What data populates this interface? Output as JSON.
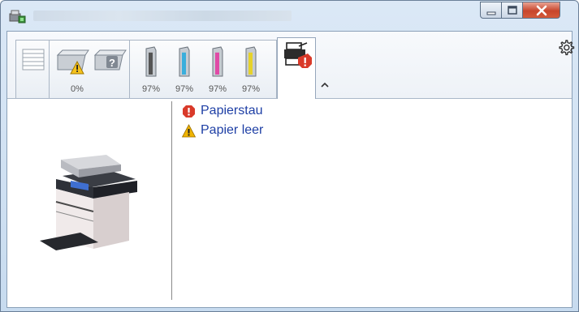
{
  "window": {
    "icons": {
      "app": "printer-app-icon",
      "minimize": "minimize-icon",
      "maximize": "maximize-icon",
      "close": "close-icon"
    }
  },
  "toolbar": {
    "machine_percent": "0%",
    "toner_levels": [
      {
        "color": "#555555",
        "percent": "97%",
        "level": 0.97
      },
      {
        "color": "#3aaedc",
        "percent": "97%",
        "level": 0.97
      },
      {
        "color": "#e04aa6",
        "percent": "97%",
        "level": 0.97
      },
      {
        "color": "#e6d22a",
        "percent": "97%",
        "level": 0.97
      }
    ],
    "icons": {
      "paper": "paper-stack-icon",
      "machine_warning": "tray-warning-icon",
      "machine_unknown": "tray-unknown-icon",
      "status": "printer-error-icon",
      "collapse": "chevron-up-icon",
      "settings": "gear-icon"
    }
  },
  "alerts": [
    {
      "text": "Papierstau",
      "icon": "error-icon",
      "color": "#d93a2a"
    },
    {
      "text": "Papier leer",
      "icon": "warning-icon",
      "color": "#f0b400"
    }
  ],
  "accent_colors": {
    "link": "#1e3fa5",
    "error": "#d93a2a",
    "warning": "#f0b400"
  }
}
